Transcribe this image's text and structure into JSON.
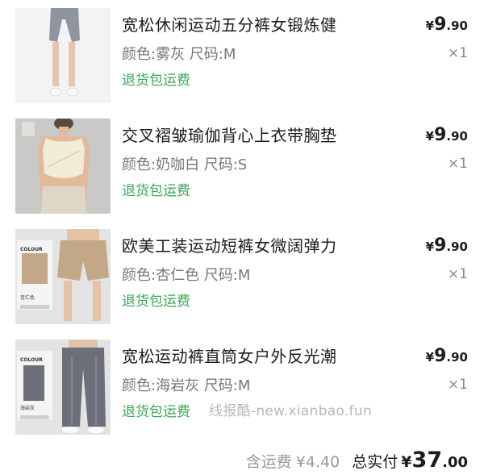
{
  "items": [
    {
      "title": "宽松休闲运动五分裤女锻炼健",
      "spec": "颜色:雾灰 尺码:M",
      "service": "退货包运费",
      "price_currency": "¥",
      "price_int": "9",
      "price_dec": ".90",
      "qty": "×1",
      "thumb_icon": "grey-shorts-model-photo",
      "colors": {
        "bg": "#f3f3f3",
        "garment": "#8e959d",
        "skin": "#e6c5ac"
      }
    },
    {
      "title": "交叉褶皱瑜伽背心上衣带胸垫",
      "spec": "颜色:奶咖白 尺码:S",
      "service": "退货包运费",
      "price_currency": "¥",
      "price_int": "9",
      "price_dec": ".90",
      "qty": "×1",
      "thumb_icon": "cream-yoga-top-model-photo",
      "colors": {
        "bg": "#c9c9c7",
        "garment": "#f1ecd6",
        "skin": "#e2b99a"
      }
    },
    {
      "title": "欧美工装运动短裤女微阔弹力",
      "spec": "颜色:杏仁色 尺码:M",
      "service": "退货包运费",
      "price_currency": "¥",
      "price_int": "9",
      "price_dec": ".90",
      "qty": "×1",
      "thumb_icon": "almond-cargo-shorts-photo",
      "colors": {
        "bg": "#e3e3e3",
        "garment": "#c2a886",
        "skin": "#e6c3a6"
      },
      "thumb_tag": "COLOUR",
      "thumb_color_label": "杏仁色"
    },
    {
      "title": "宽松运动裤直筒女户外反光潮",
      "spec": "颜色:海岩灰 尺码:M",
      "service": "退货包运费",
      "price_currency": "¥",
      "price_int": "9",
      "price_dec": ".90",
      "qty": "×1",
      "thumb_icon": "grey-straight-pants-photo",
      "colors": {
        "bg": "#e3e3e3",
        "garment": "#6c6f7a",
        "skin": "#e2c2a8"
      },
      "thumb_tag": "COLOUR",
      "thumb_color_label": "海岩灰"
    }
  ],
  "watermark": "线报酷-new.xianbao.fun",
  "footer": {
    "shipping_label": "含运费",
    "shipping_value": "¥4.40",
    "total_label": "总实付",
    "total_currency": "¥",
    "total_int": "37",
    "total_dec": ".00"
  },
  "accent_green": "#3aa655"
}
